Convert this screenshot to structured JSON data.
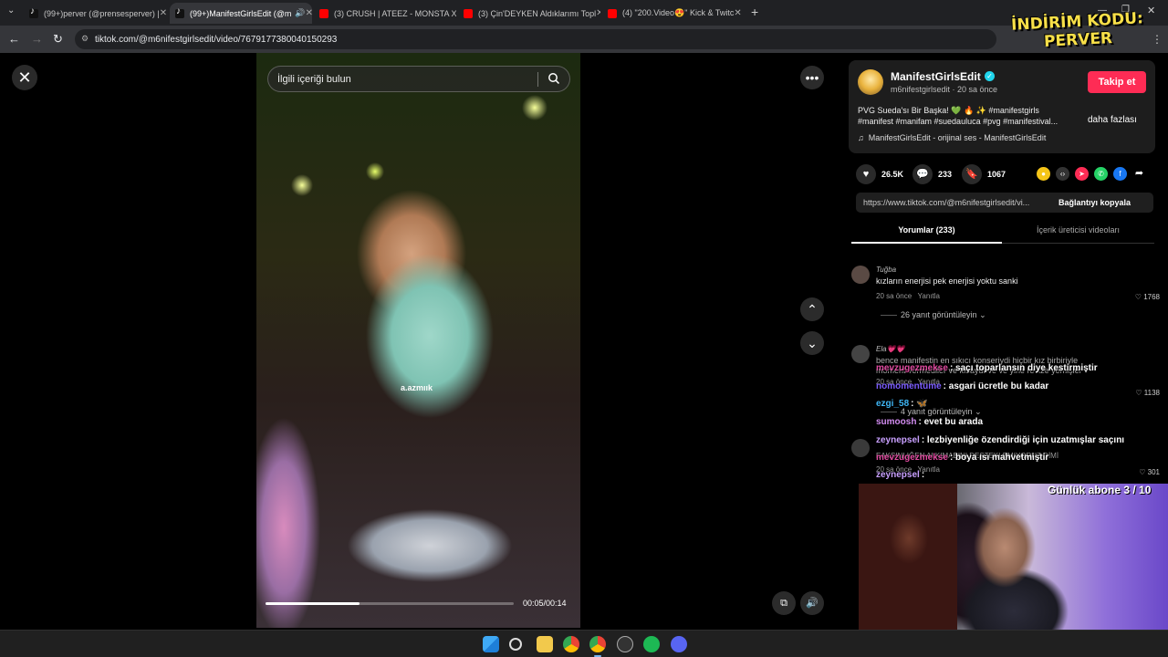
{
  "browser": {
    "tabs": [
      {
        "title": "(99+)perver (@prensesperver) |",
        "icon": "tiktok-icon",
        "active": false
      },
      {
        "title": "(99+)ManifestGirlsEdit (@m",
        "icon": "tiktok-icon",
        "active": true
      },
      {
        "title": "(3) CRUSH | ATEEZ - MONSTA X",
        "icon": "youtube-icon",
        "active": false
      },
      {
        "title": "(3) Çin'DEYKEN Aldıklarımı Topl",
        "icon": "youtube-icon",
        "active": false
      },
      {
        "title": "(4) \"200.Video😍\" Kick & Twitc",
        "icon": "youtube-icon",
        "active": false
      }
    ],
    "url": "tiktok.com/@m6nifestgirlsedit/video/7679177380040150293"
  },
  "overlay": {
    "promo_line1": "İNDİRİM KODU:",
    "promo_line2": "PERVER"
  },
  "video": {
    "search_placeholder": "İlgili içeriği bulun",
    "watermark": "a.azmıık",
    "progress": 0.38,
    "timecode": "00:05/00:14"
  },
  "post": {
    "author_name": "ManifestGirlsEdit",
    "author_handle": "m6nifestgirlsedit",
    "posted": "20 sa önce",
    "follow_label": "Takip et",
    "description": "PVG Sueda'sı Bir Başka! 💚 🔥 ✨ #manifestgirls #manifest #manifam #suedaulucа #pvg #manifestival...",
    "more_label": "daha fazlası",
    "music": "ManifestGirlsEdit - orijinal ses - ManifestGirlsEdit",
    "likes": "26.5K",
    "comments": "233",
    "saves": "1067",
    "share_link": "https://www.tiktok.com/@m6nifestgirlsedit/vi...",
    "copy_label": "Bağlantıyı kopyala"
  },
  "panel_tabs": {
    "comments": "Yorumlar (233)",
    "creator_videos": "İçerik üreticisi videoları"
  },
  "comments": [
    {
      "user": "Tuğba",
      "text": "kızların enerjisi pek enerjisi yoktu sanki",
      "time": "20 sa önce",
      "reply": "Yanıtla",
      "likes": "1768",
      "replies": "26 yanıt görüntüleyin"
    },
    {
      "user": "Ela💗💗",
      "text": "bence manifestin en sıkıcı konseriydi hiçbir kız birbiriyle",
      "text2": "moment vermediler ve kısaydı ve ve yine revize yemişler",
      "time": "20 sa önce",
      "reply": "Yanıtla",
      "likes": "1138",
      "replies": "4 yanıt görüntüleyin"
    },
    {
      "user": "",
      "text": "EAKSINLIĞEN ALKIMABINI DESTEKLEMIYORUZ DİMİ",
      "time": "20 sa önce",
      "reply": "Yanıtla",
      "likes": "301",
      "replies": ""
    }
  ],
  "stream_chat": [
    {
      "user": "mevzugezmekse",
      "msg": "saçı toparlansın diye kestirmiştir",
      "color": "#e04aa0"
    },
    {
      "user": "nomomentume",
      "msg": "asgari ücretle bu kadar",
      "color": "#7b5cff"
    },
    {
      "user": "ezgi_58",
      "msg": "🦋",
      "color": "#3fb6f5"
    },
    {
      "user": "sumoosh",
      "msg": "evet bu arada",
      "color": "#d28cf0"
    },
    {
      "user": "zeynepsel",
      "msg": "lezbiyenliğe özendirdiği için uzatmışlar saçını",
      "color": "#c9a0ff"
    },
    {
      "user": "mevzugezmekse",
      "msg": "boya ısı mahvetmiştir",
      "color": "#e04aa0"
    },
    {
      "user": "zeynepsel",
      "msg": "",
      "color": "#c9a0ff"
    }
  ],
  "stream": {
    "goal": "Günlük abone 3 / 10"
  },
  "colors": {
    "accent": "#fe2c55",
    "verified": "#20d5ec",
    "promo": "#f8e048"
  }
}
